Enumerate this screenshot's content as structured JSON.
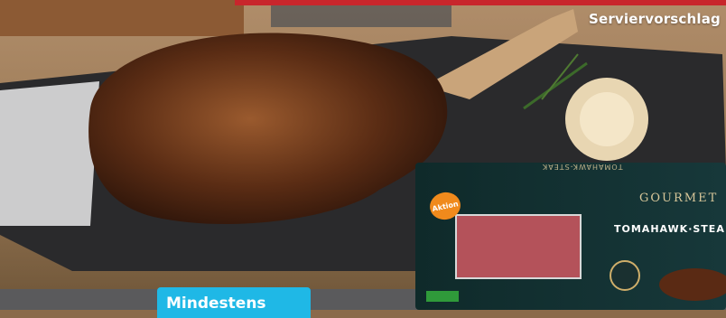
{
  "caption": "Serviervorschlag",
  "badge": "Mindestens",
  "package": {
    "brand": "GOURMET",
    "title": "TOMAHAWK·STEA",
    "upside_down_title": "TOMAHAWK-STEAK",
    "aktion": "Aktion"
  }
}
